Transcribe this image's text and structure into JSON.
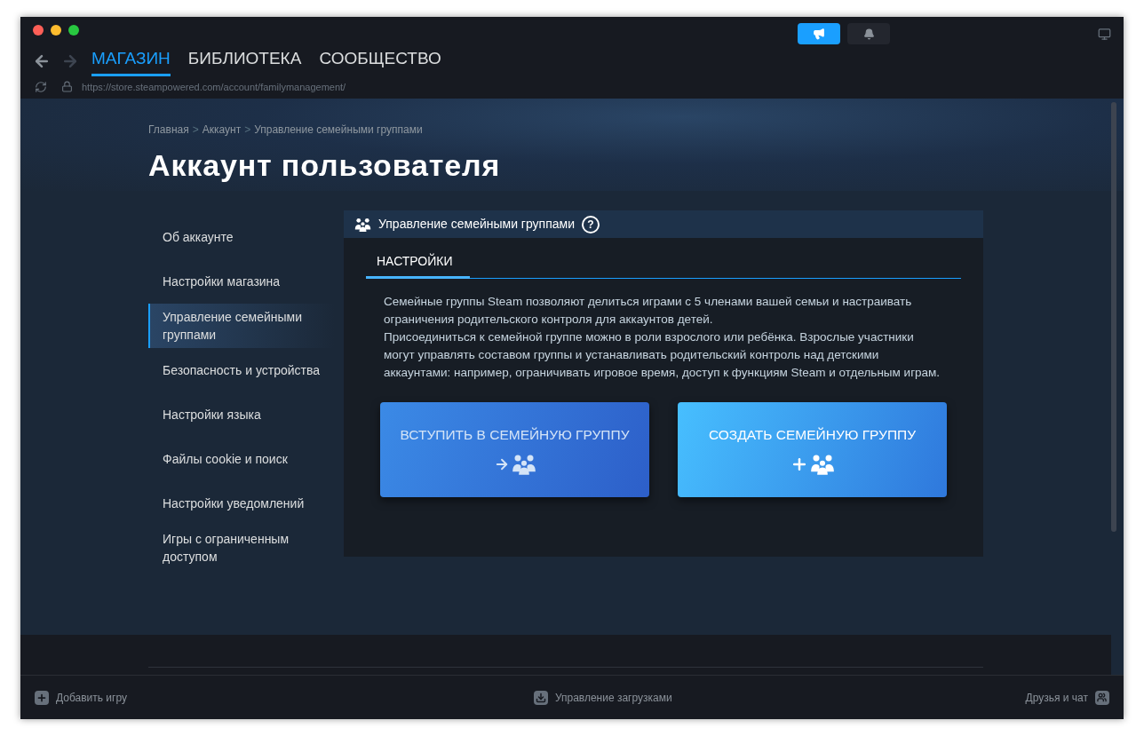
{
  "nav": {
    "tabs": [
      {
        "label": "МАГАЗИН",
        "selected": true
      },
      {
        "label": "БИБЛИОТЕКА",
        "selected": false
      },
      {
        "label": "СООБЩЕСТВО",
        "selected": false
      }
    ],
    "url": "https://store.steampowered.com/account/familymanagement/"
  },
  "breadcrumbs": [
    "Главная",
    "Аккаунт",
    "Управление семейными группами"
  ],
  "breadcrumb_separator": ">",
  "page_title": "Аккаунт пользователя",
  "sidebar": {
    "items": [
      {
        "label": "Об аккаунте",
        "selected": false
      },
      {
        "label": "Настройки магазина",
        "selected": false
      },
      {
        "label": "Управление семейными группами",
        "selected": true
      },
      {
        "label": "Безопасность и устройства",
        "selected": false
      },
      {
        "label": "Настройки языка",
        "selected": false
      },
      {
        "label": "Файлы cookie и поиск",
        "selected": false
      },
      {
        "label": "Настройки уведомлений",
        "selected": false
      },
      {
        "label": "Игры с ограниченным доступом",
        "selected": false
      }
    ]
  },
  "panel": {
    "title": "Управление семейными группами",
    "help": "?",
    "tabs": [
      {
        "label": "НАСТРОЙКИ",
        "selected": true
      }
    ],
    "paragraphs": [
      "Семейные группы Steam позволяют делиться играми с 5 членами вашей семьи и настраивать ограничения родительского контроля для аккаунтов детей.",
      "Присоединиться к семейной группе можно в роли взрослого или ребёнка. Взрослые участники могут управлять составом группы и устанавливать родительский контроль над детскими аккаунтами: например, ограничивать игровое время, доступ к функциям Steam и отдельным играм."
    ],
    "buttons": [
      {
        "label": "ВСТУПИТЬ В СЕМЕЙНУЮ ГРУППУ",
        "kind": "join"
      },
      {
        "label": "СОЗДАТЬ СЕМЕЙНУЮ ГРУППУ",
        "kind": "create"
      }
    ]
  },
  "bottom_bar": {
    "add_game": "Добавить игру",
    "downloads": "Управление загрузками",
    "friends": "Друзья и чат"
  }
}
